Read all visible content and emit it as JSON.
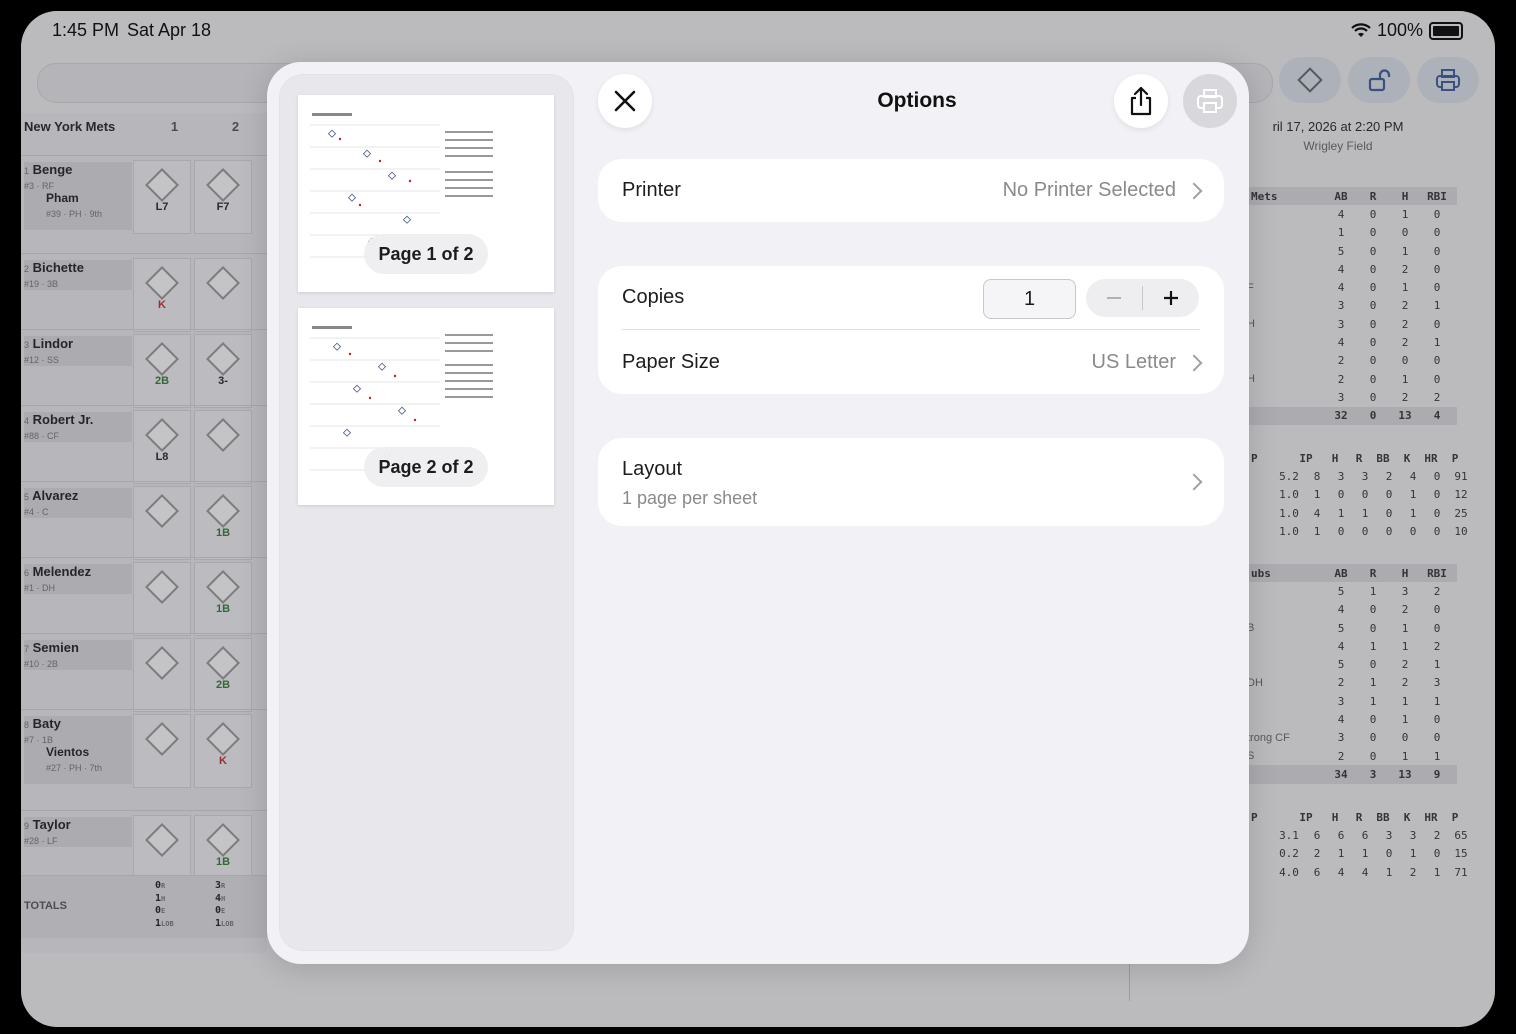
{
  "status_bar": {
    "time": "1:45 PM",
    "date": "Sat Apr 18",
    "battery": "100%"
  },
  "background": {
    "team_header": "New York Mets",
    "innings": [
      "1",
      "2"
    ],
    "players": [
      {
        "num": "1",
        "name": "Benge",
        "sub": "#3 · RF",
        "sub_name": "Pham",
        "sub_info": "#39 · PH · 9th",
        "r1": "L7",
        "r2": "F7"
      },
      {
        "num": "2",
        "name": "Bichette",
        "sub": "#19 · 3B",
        "r1": "K",
        "r2": ""
      },
      {
        "num": "3",
        "name": "Lindor",
        "sub": "#12 · SS",
        "r1": "2B",
        "r2": "3-"
      },
      {
        "num": "4",
        "name": "Robert Jr.",
        "sub": "#88 · CF",
        "r1": "L8",
        "r2": ""
      },
      {
        "num": "5",
        "name": "Alvarez",
        "sub": "#4 · C",
        "r1": "",
        "r2": "1B"
      },
      {
        "num": "6",
        "name": "Melendez",
        "sub": "#1 · DH",
        "r1": "",
        "r2": "1B"
      },
      {
        "num": "7",
        "name": "Semien",
        "sub": "#10 · 2B",
        "r1": "",
        "r2": "2B"
      },
      {
        "num": "8",
        "name": "Baty",
        "sub": "#7 · 1B",
        "sub_name": "Vientos",
        "sub_info": "#27 · PH · 7th",
        "r1": "",
        "r2": "K"
      },
      {
        "num": "9",
        "name": "Taylor",
        "sub": "#28 · LF",
        "r1": "",
        "r2": "1B"
      }
    ],
    "totals_label": "TOTALS",
    "totals": [
      [
        "0",
        "1",
        "0",
        "1"
      ],
      [
        "3",
        "4",
        "0",
        "1"
      ]
    ],
    "totals_keys": [
      "R",
      "H",
      "E",
      "LOB"
    ],
    "game_date": "ril 17, 2026 at 2:20 PM",
    "venue": "Wrigley Field",
    "box1": {
      "title": "Mets",
      "cols": [
        "AB",
        "R",
        "H",
        "RBI"
      ],
      "side": [
        "",
        "",
        "",
        "",
        "F",
        "",
        "H",
        "",
        "",
        "H",
        ""
      ],
      "rows": [
        [
          "4",
          "0",
          "1",
          "0"
        ],
        [
          "1",
          "0",
          "0",
          "0"
        ],
        [
          "5",
          "0",
          "1",
          "0"
        ],
        [
          "4",
          "0",
          "2",
          "0"
        ],
        [
          "4",
          "0",
          "1",
          "0"
        ],
        [
          "3",
          "0",
          "2",
          "1"
        ],
        [
          "3",
          "0",
          "2",
          "0"
        ],
        [
          "4",
          "0",
          "2",
          "1"
        ],
        [
          "2",
          "0",
          "0",
          "0"
        ],
        [
          "2",
          "0",
          "1",
          "0"
        ],
        [
          "3",
          "0",
          "2",
          "2"
        ]
      ],
      "total": [
        "32",
        "0",
        "13",
        "4"
      ]
    },
    "pit1": {
      "title": "P",
      "cols": [
        "IP",
        "H",
        "R",
        "BB",
        "K",
        "HR",
        "P"
      ],
      "rows": [
        [
          "5.2",
          "8",
          "3",
          "3",
          "2",
          "4",
          "0",
          "91"
        ],
        [
          "1.0",
          "1",
          "0",
          "0",
          "0",
          "1",
          "0",
          "12"
        ],
        [
          "1.0",
          "4",
          "1",
          "1",
          "0",
          "1",
          "0",
          "25"
        ],
        [
          "1.0",
          "1",
          "0",
          "0",
          "0",
          "0",
          "0",
          "10"
        ]
      ]
    },
    "box2": {
      "title": "ubs",
      "cols": [
        "AB",
        "R",
        "H",
        "RBI"
      ],
      "side": [
        "",
        "",
        "B",
        "",
        "",
        "DH",
        "",
        "",
        "trong CF",
        "S"
      ],
      "rows": [
        [
          "5",
          "1",
          "3",
          "2"
        ],
        [
          "4",
          "0",
          "2",
          "0"
        ],
        [
          "5",
          "0",
          "1",
          "0"
        ],
        [
          "4",
          "1",
          "1",
          "2"
        ],
        [
          "5",
          "0",
          "2",
          "1"
        ],
        [
          "2",
          "1",
          "2",
          "3"
        ],
        [
          "3",
          "1",
          "1",
          "1"
        ],
        [
          "4",
          "0",
          "1",
          "0"
        ],
        [
          "3",
          "0",
          "0",
          "0"
        ],
        [
          "2",
          "0",
          "1",
          "1"
        ]
      ],
      "total": [
        "34",
        "3",
        "13",
        "9"
      ]
    },
    "pit2": {
      "title": "P",
      "cols": [
        "IP",
        "H",
        "R",
        "BB",
        "K",
        "HR",
        "P"
      ],
      "rows": [
        [
          "3.1",
          "6",
          "6",
          "6",
          "3",
          "3",
          "2",
          "65"
        ],
        [
          "0.2",
          "2",
          "1",
          "1",
          "0",
          "1",
          "0",
          "15"
        ],
        [
          "4.0",
          "6",
          "4",
          "4",
          "1",
          "2",
          "1",
          "71"
        ]
      ]
    }
  },
  "modal": {
    "title": "Options",
    "pages": [
      "Page 1 of 2",
      "Page 2 of 2"
    ],
    "printer": {
      "label": "Printer",
      "value": "No Printer Selected"
    },
    "copies": {
      "label": "Copies",
      "value": "1"
    },
    "paper": {
      "label": "Paper Size",
      "value": "US Letter"
    },
    "layout": {
      "label": "Layout",
      "value": "1 page per sheet"
    }
  },
  "colors": {
    "accent": "#3a5a9b",
    "badge": "#8b1f1f",
    "hit_green": "#2e7d32",
    "strikeout_red": "#c62828"
  },
  "icons": [
    "wifi-icon",
    "battery-icon",
    "diamond-icon",
    "unlock-icon",
    "print-icon",
    "close-icon",
    "share-icon",
    "chevron-right-icon",
    "minus-icon",
    "plus-icon"
  ]
}
